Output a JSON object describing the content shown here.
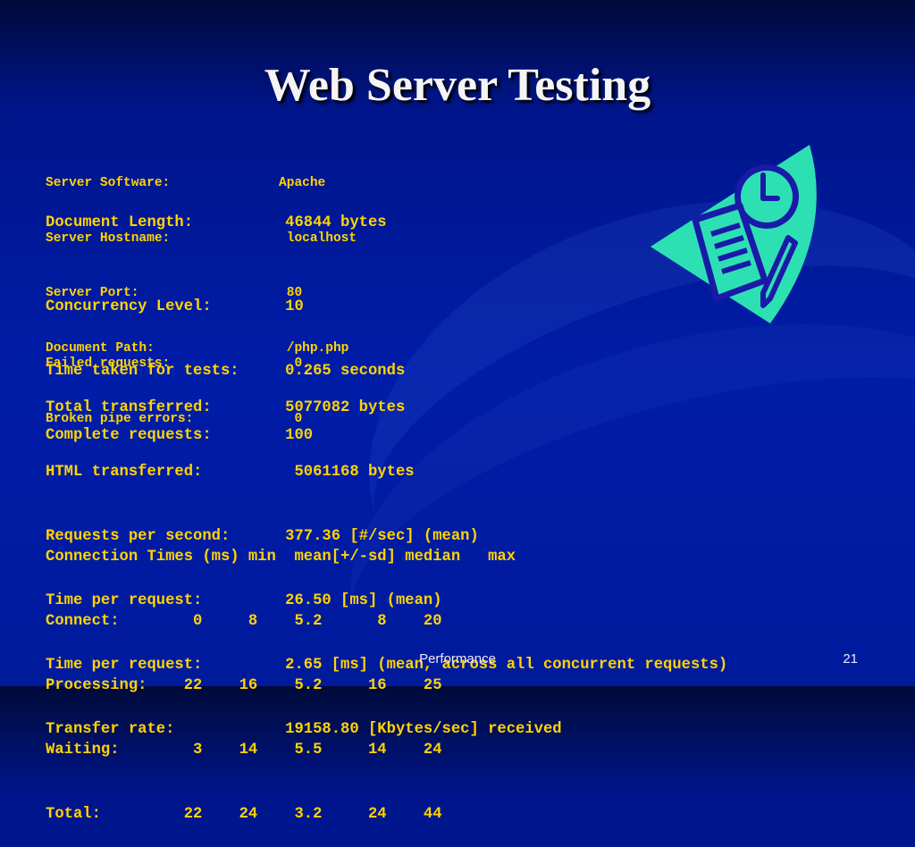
{
  "slide": {
    "title": "Web Server Testing",
    "footer": "Performance",
    "page_number": "21"
  },
  "colors": {
    "text_accent": "#ffd400",
    "background": "#001da8",
    "clipart": "#2de0b4"
  },
  "icons": [
    "clock-icon",
    "document-icon",
    "pencil-icon"
  ],
  "report": {
    "small_lines": [
      "Server Software:              Apache",
      "Server Hostname:               localhost",
      "Server Port:                   80",
      "Document Path:                 /php.php"
    ],
    "document_length": "Document Length:          46844 bytes",
    "lines_a": [
      "Concurrency Level:        10",
      "Time taken for tests:     0.265 seconds",
      "Complete requests:        100"
    ],
    "small_lines_b": [
      "Failed requests:                0",
      "Broken pipe errors:             0"
    ],
    "lines_b": [
      "Total transferred:        5077082 bytes",
      "HTML transferred:          5061168 bytes",
      "Requests per second:      377.36 [#/sec] (mean)",
      "Time per request:         26.50 [ms] (mean)",
      "Time per request:         2.65 [ms] (mean, across all concurrent requests)",
      "Transfer rate:            19158.80 [Kbytes/sec] received"
    ],
    "connection_times": [
      "Connection Times (ms) min  mean[+/-sd] median   max",
      "Connect:        0     8    5.2      8    20",
      "Processing:    22    16    5.2     16    25",
      "Waiting:        3    14    5.5     14    24",
      "Total:         22    24    3.2     24    44"
    ]
  }
}
